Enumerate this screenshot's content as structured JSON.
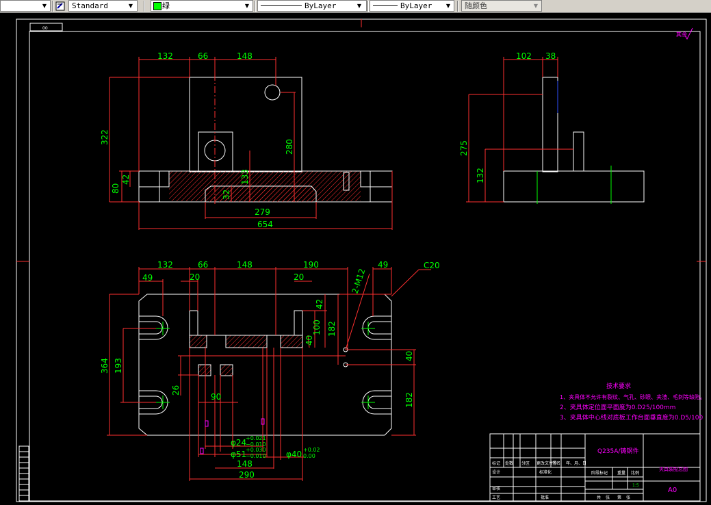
{
  "toolbar": {
    "text_style": "Standard",
    "layer_color": "绿",
    "linetype": "ByLayer",
    "lineweight": "ByLayer",
    "plot_color": "随颜色"
  },
  "drawing": {
    "roughness": "其余",
    "top_dims": [
      "132",
      "66",
      "148"
    ],
    "side_top_dims": [
      "102",
      "38"
    ],
    "front_height": "322",
    "front_hole_height": "280",
    "front_base_height": "80",
    "front_small_42": "42",
    "front_133": "133",
    "front_32": "32",
    "front_279": "279",
    "front_654": "654",
    "side_275": "275",
    "side_132": "132",
    "plan_top_dims": [
      "132",
      "66",
      "148",
      "190"
    ],
    "plan_49_left": "49",
    "plan_49_right": "49",
    "plan_20_left": "20",
    "plan_20_right": "20",
    "thread": "2-M12",
    "chamfer": "C20",
    "plan_42": "42",
    "plan_100": "100",
    "plan_182_top": "182",
    "plan_40_small": "40",
    "plan_40_right": "40",
    "plan_182_bottom": "182",
    "plan_364": "364",
    "plan_193": "193",
    "plan_26": "26",
    "plan_90": "90",
    "fit_24": "φ24",
    "fit_24_up": "+0.021",
    "fit_24_lo": "−0.010",
    "fit_51": "φ51",
    "fit_51_up": "+0.030",
    "fit_51_lo": "−0.010",
    "fit_40": "φ40",
    "fit_40_up": "+0.02",
    "fit_40_lo": "0.00",
    "plan_148": "148",
    "plan_290": "290",
    "notes_title": "技术要求",
    "notes": [
      "1、夹具体不允许有裂纹、气孔、砂眼、夹渣、毛刺等缺陷。",
      "2、夹具体定位面平面度为0.D25/100mm",
      "3、夹具体中心线对底板工作台面垂直度为0.D5/100"
    ],
    "material": "Q235A/铸钢件",
    "drawing_title": "夹具装配总图",
    "scale": "1:5",
    "sheet_size": "A0",
    "tb_labels": [
      "标记",
      "处数",
      "分区",
      "更改文件号",
      "签名",
      "年、月、日",
      "设计",
      "标准化",
      "阶段标记",
      "重量",
      "比例",
      "审核",
      "工艺",
      "批准",
      "共",
      "张",
      "第",
      "张"
    ],
    "badge": "00"
  }
}
